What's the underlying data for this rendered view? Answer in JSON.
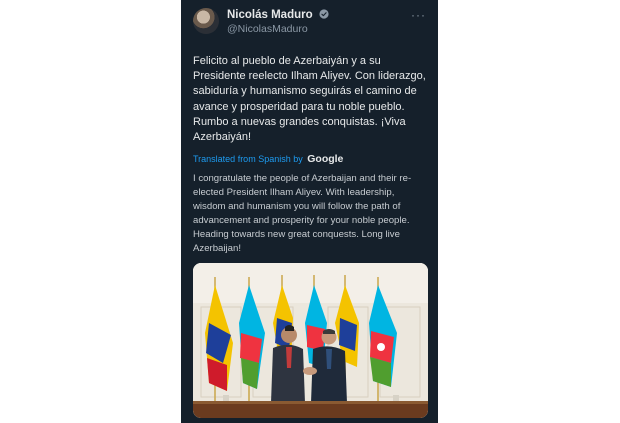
{
  "author": {
    "name": "Nicolás Maduro",
    "handle": "@NicolasMaduro"
  },
  "more_label": "···",
  "tweet": {
    "lines": [
      "Felicito al pueblo de Azerbaiyán y a su",
      "Presidente reelecto Ilham Aliyev. Con liderazgo,",
      "sabiduría y humanismo seguirás el camino de",
      "avance y prosperidad para tu noble pueblo.",
      "Rumbo a nuevas grandes conquistas. ¡Viva",
      "Azerbaiyán!"
    ]
  },
  "translation": {
    "label": "Translated from Spanish by",
    "provider": "Google",
    "lines": [
      "I congratulate the people of Azerbaijan and their re-",
      "elected President Ilham Aliyev. With leadership,",
      "wisdom and humanism you will follow the path of",
      "advancement and prosperity for your noble people.",
      "Heading towards new great conquests. Long live",
      "Azerbaijan!"
    ]
  },
  "colors": {
    "background": "#15202b",
    "text": "#e7e9ea",
    "secondary": "#8b98a5",
    "accent": "#1d9bf0"
  },
  "icons": {
    "verified": "verified-badge-icon",
    "more": "more-options-icon"
  }
}
